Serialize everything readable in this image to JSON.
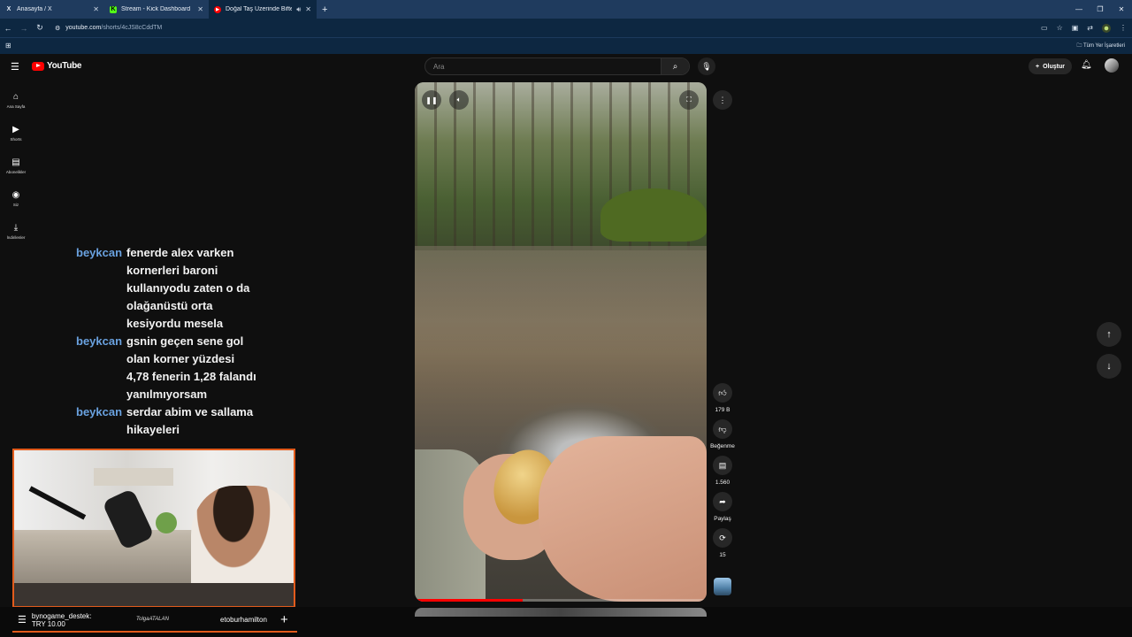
{
  "browser": {
    "tabs": [
      {
        "label": "Anasayfa / X",
        "favicon": "X"
      },
      {
        "label": "Stream - Kick Dashboard",
        "favicon": "K"
      },
      {
        "label": "Doğal Taş Üzerinde Biftek P",
        "favicon": "▶"
      }
    ],
    "url_domain": "youtube.com",
    "url_path": "/shorts/4cJS8cCddTM",
    "bookmarks_all": "Tüm Yer İşaretleri"
  },
  "youtube": {
    "logo_text": "YouTube",
    "search_placeholder": "Ara",
    "create_label": "Oluştur",
    "rail": [
      {
        "label": "Ana Sayfa",
        "icon": "home-icon"
      },
      {
        "label": "Shorts",
        "icon": "shorts-icon"
      },
      {
        "label": "Abonelikler",
        "icon": "subscriptions-icon"
      },
      {
        "label": "Siz",
        "icon": "you-icon"
      },
      {
        "label": "İndirilenler",
        "icon": "download-icon"
      }
    ],
    "actions": {
      "like_count": "179 B",
      "dislike_label": "Beğenme",
      "comments_count": "1.560",
      "share_label": "Paylaş",
      "remix_count": "15"
    },
    "progress": 0.37
  },
  "chat": [
    {
      "user": "beykcan",
      "text": "fenerde alex varken kornerleri baroni kullanıyodu zaten o da olağanüstü orta kesiyordu mesela"
    },
    {
      "user": "beykcan",
      "text": "gsnin geçen sene gol olan korner yüzdesi 4,78 fenerin 1,28 falandı yanılmıyorsam"
    },
    {
      "user": "beykcan",
      "text": "serdar abim ve sallama hikayeleri"
    }
  ],
  "overlay": {
    "donor": "bynogame_destek:",
    "amount": "TRY 10.00",
    "signature": "TolgaATALAN",
    "name": "etoburhamilton"
  }
}
